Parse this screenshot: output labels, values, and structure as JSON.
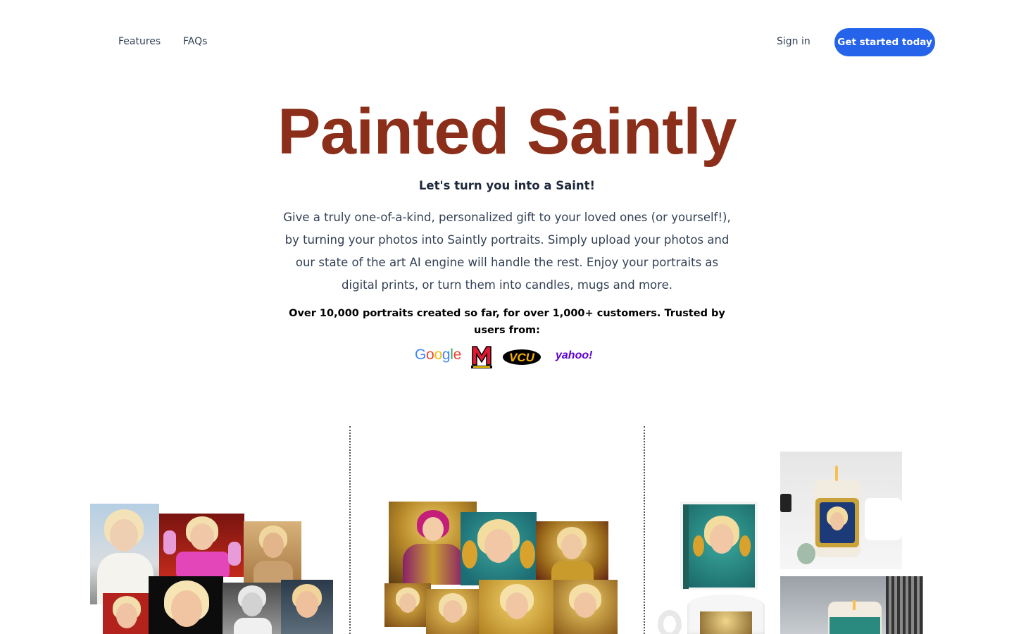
{
  "nav": {
    "features": "Features",
    "faqs": "FAQs",
    "sign_in": "Sign in",
    "cta": "Get started today"
  },
  "hero": {
    "title": "Painted Saintly",
    "subtitle": "Let's turn you into a Saint!",
    "description": "Give a truly one-of-a-kind, personalized gift to your loved ones (or yourself!), by turning your photos into Saintly portraits. Simply upload your photos and our state of the art AI engine will handle the rest. Enjoy your portraits as digital prints, or turn them into candles, mugs and more.",
    "trust": "Over 10,000 portraits created so far, for over 1,000+ customers. Trusted by users from:"
  },
  "logos": {
    "google": "Google",
    "maryland": "M",
    "vcu": "VCU",
    "yahoo": "yahoo!"
  },
  "colors": {
    "title": "#8b2f1a",
    "cta": "#2563eb",
    "text": "#334155"
  }
}
